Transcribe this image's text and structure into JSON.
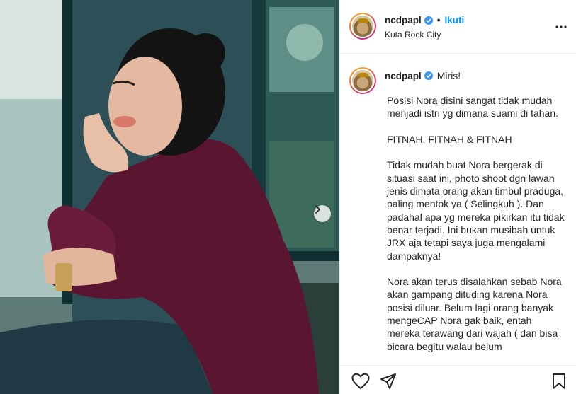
{
  "post": {
    "username": "ncdpapl",
    "follow_label": "Ikuti",
    "dot": "•",
    "location": "Kuta Rock City",
    "caption_first_line": "Miris!",
    "caption_body": "Posisi Nora disini sangat tidak mudah menjadi istri yg dimana suami di tahan.\n\nFITNAH, FITNAH & FITNAH\n\nTidak mudah buat Nora bergerak di situasi saat ini, photo shoot dgn lawan jenis dimata orang akan timbul praduga, paling mentok ya ( Selingkuh ). Dan padahal apa yg mereka pikirkan itu tidak benar terjadi. Ini bukan musibah untuk JRX aja tetapi saya juga mengalami dampaknya!\n\nNora akan terus disalahkan sebab Nora akan gampang dituding karena Nora posisi diluar. Belum lagi orang banyak mengeCAP Nora gak baik, entah mereka terawang dari wajah ( dan bisa bicara begitu walau belum"
  },
  "icons": {
    "verified": "verified-badge-icon",
    "more": "more-options-icon",
    "next": "chevron-right-icon",
    "like": "heart-icon",
    "share": "paper-plane-icon",
    "save": "bookmark-icon"
  },
  "colors": {
    "follow": "#0095f6",
    "verified": "#3897f0",
    "border": "#efefef"
  }
}
